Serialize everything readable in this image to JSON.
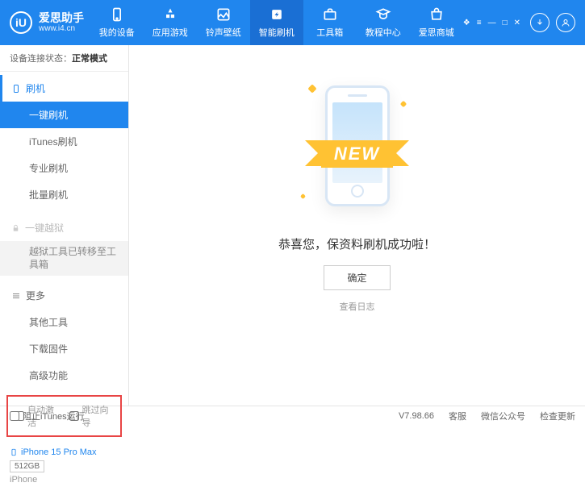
{
  "header": {
    "logo_char": "iU",
    "app_name": "爱思助手",
    "site": "www.i4.cn",
    "tabs": [
      {
        "label": "我的设备"
      },
      {
        "label": "应用游戏"
      },
      {
        "label": "铃声壁纸"
      },
      {
        "label": "智能刷机"
      },
      {
        "label": "工具箱"
      },
      {
        "label": "教程中心"
      },
      {
        "label": "爱思商城"
      }
    ]
  },
  "sidebar": {
    "status_label": "设备连接状态：",
    "status_value": "正常模式",
    "sec_flash": "刷机",
    "items_flash": [
      "一键刷机",
      "iTunes刷机",
      "专业刷机",
      "批量刷机"
    ],
    "sec_jailbreak": "一键越狱",
    "jailbreak_note": "越狱工具已转移至工具箱",
    "sec_more": "更多",
    "items_more": [
      "其他工具",
      "下载固件",
      "高级功能"
    ],
    "cb_auto": "自动激活",
    "cb_skip": "跳过向导",
    "device_name": "iPhone 15 Pro Max",
    "device_storage": "512GB",
    "device_type": "iPhone"
  },
  "main": {
    "ribbon": "NEW",
    "success": "恭喜您，保资料刷机成功啦！",
    "ok_btn": "确定",
    "log_link": "查看日志"
  },
  "footer": {
    "block_itunes": "阻止iTunes运行",
    "version": "V7.98.66",
    "links": [
      "客服",
      "微信公众号",
      "检查更新"
    ]
  }
}
